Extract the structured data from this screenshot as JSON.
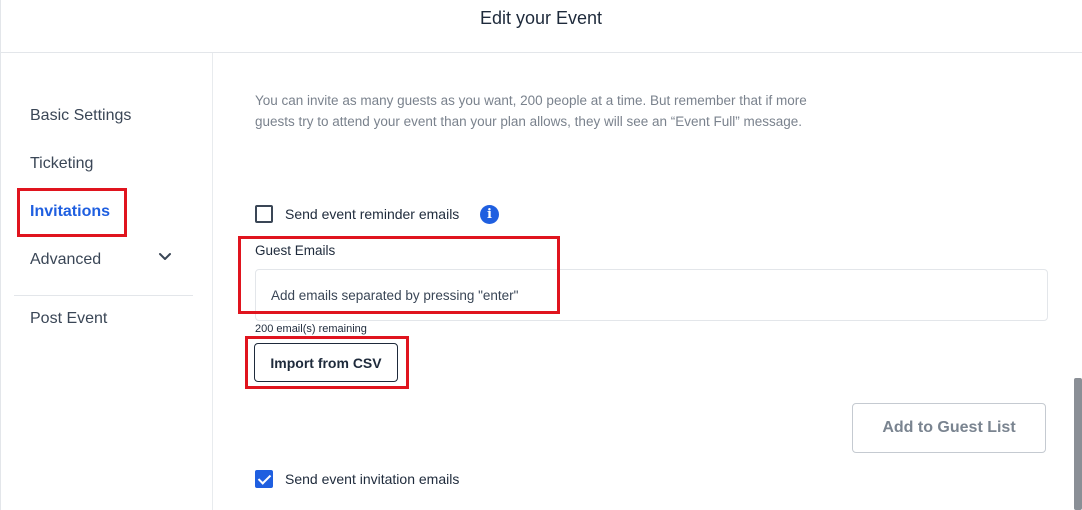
{
  "header": {
    "title": "Edit your Event"
  },
  "sidebar": {
    "items": [
      {
        "label": "Basic Settings"
      },
      {
        "label": "Ticketing"
      },
      {
        "label": "Invitations"
      },
      {
        "label": "Advanced"
      },
      {
        "label": "Post Event"
      }
    ],
    "active": "Invitations"
  },
  "main": {
    "intro": "You can invite as many guests as you want, 200 people at a time. But remember that if more guests try to attend your event than your plan allows, they will see an “Event Full” message.",
    "reminder": {
      "label": "Send event reminder emails",
      "checked": false
    },
    "guest_emails": {
      "label": "Guest Emails",
      "placeholder": "Add emails separated by pressing \"enter\"",
      "value": "",
      "remaining": "200 email(s) remaining"
    },
    "import_button": "Import from CSV",
    "add_button": "Add to Guest List",
    "invitation": {
      "label": "Send event invitation emails",
      "checked": true
    }
  },
  "colors": {
    "accent": "#1f5fe0",
    "highlight": "#e0141e",
    "text": "#1e2a3b",
    "muted": "#7a828d"
  },
  "icons": {
    "info": "info-icon",
    "chevron": "chevron-down-icon"
  }
}
